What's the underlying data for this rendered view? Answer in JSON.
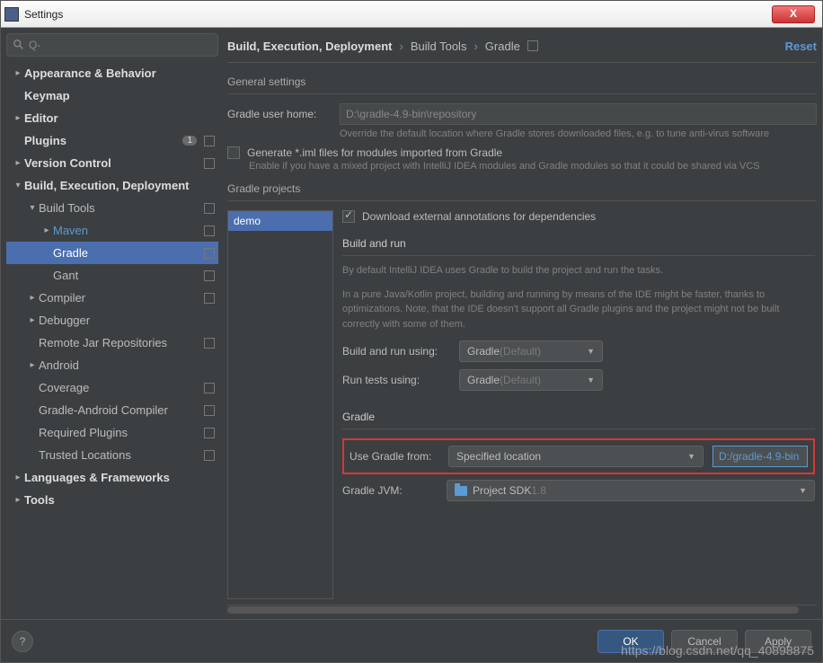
{
  "window": {
    "title": "Settings",
    "close": "X"
  },
  "search": {
    "placeholder": "Q-"
  },
  "tree": [
    {
      "level": 0,
      "arrow": ">",
      "label": "Appearance & Behavior",
      "bold": true
    },
    {
      "level": 0,
      "arrow": "",
      "label": "Keymap",
      "bold": true,
      "noarrow": true
    },
    {
      "level": 0,
      "arrow": ">",
      "label": "Editor",
      "bold": true
    },
    {
      "level": 0,
      "arrow": "",
      "label": "Plugins",
      "bold": true,
      "noarrow": true,
      "badge": "1",
      "cfg": true
    },
    {
      "level": 0,
      "arrow": ">",
      "label": "Version Control",
      "bold": true,
      "cfg": true
    },
    {
      "level": 0,
      "arrow": "v",
      "label": "Build, Execution, Deployment",
      "bold": true
    },
    {
      "level": 1,
      "arrow": "v",
      "label": "Build Tools",
      "cfg": true
    },
    {
      "level": 2,
      "arrow": ">",
      "label": "Maven",
      "link": true,
      "cfg": true
    },
    {
      "level": 2,
      "arrow": "",
      "label": "Gradle",
      "selected": true,
      "noarrow": true,
      "cfg": true
    },
    {
      "level": 2,
      "arrow": "",
      "label": "Gant",
      "noarrow": true,
      "cfg": true
    },
    {
      "level": 1,
      "arrow": ">",
      "label": "Compiler",
      "cfg": true
    },
    {
      "level": 1,
      "arrow": ">",
      "label": "Debugger"
    },
    {
      "level": 1,
      "arrow": "",
      "label": "Remote Jar Repositories",
      "noarrow": true,
      "cfg": true
    },
    {
      "level": 1,
      "arrow": ">",
      "label": "Android"
    },
    {
      "level": 1,
      "arrow": "",
      "label": "Coverage",
      "noarrow": true,
      "cfg": true
    },
    {
      "level": 1,
      "arrow": "",
      "label": "Gradle-Android Compiler",
      "noarrow": true,
      "cfg": true
    },
    {
      "level": 1,
      "arrow": "",
      "label": "Required Plugins",
      "noarrow": true,
      "cfg": true
    },
    {
      "level": 1,
      "arrow": "",
      "label": "Trusted Locations",
      "noarrow": true,
      "cfg": true
    },
    {
      "level": 0,
      "arrow": ">",
      "label": "Languages & Frameworks",
      "bold": true
    },
    {
      "level": 0,
      "arrow": ">",
      "label": "Tools",
      "bold": true
    }
  ],
  "crumbs": {
    "a": "Build, Execution, Deployment",
    "b": "Build Tools",
    "c": "Gradle",
    "reset": "Reset"
  },
  "general": {
    "title": "General settings",
    "home_label": "Gradle user home:",
    "home_value": "D:\\gradle-4.9-bin\\repository",
    "home_hint": "Override the default location where Gradle stores downloaded files, e.g. to tune anti-virus software",
    "iml_label": "Generate *.iml files for modules imported from Gradle",
    "iml_hint": "Enable if you have a mixed project with IntelliJ IDEA modules and Gradle modules so that it could be shared via VCS"
  },
  "gp": {
    "title": "Gradle projects",
    "project": "demo",
    "download_label": "Download external annotations for dependencies",
    "run_title": "Build and run",
    "run_desc1": "By default IntelliJ IDEA uses Gradle to build the project and run the tasks.",
    "run_desc2": "In a pure Java/Kotlin project, building and running by means of the IDE might be faster, thanks to optimizations. Note, that the IDE doesn't support all Gradle plugins and the project might not be built correctly with some of them.",
    "build_label": "Build and run using:",
    "tests_label": "Run tests using:",
    "combo_main": "Gradle ",
    "combo_dim": "(Default)",
    "gradle_title": "Gradle",
    "use_from_label": "Use Gradle from:",
    "use_from_value": "Specified location",
    "path_value": "D:/gradle-4.9-bin",
    "jvm_label": "Gradle JVM:",
    "jvm_value": "Project SDK ",
    "jvm_ver": "1.8"
  },
  "footer": {
    "help": "?",
    "ok": "OK",
    "cancel": "Cancel",
    "apply": "Apply"
  },
  "watermark": "https://blog.csdn.net/qq_40898875"
}
